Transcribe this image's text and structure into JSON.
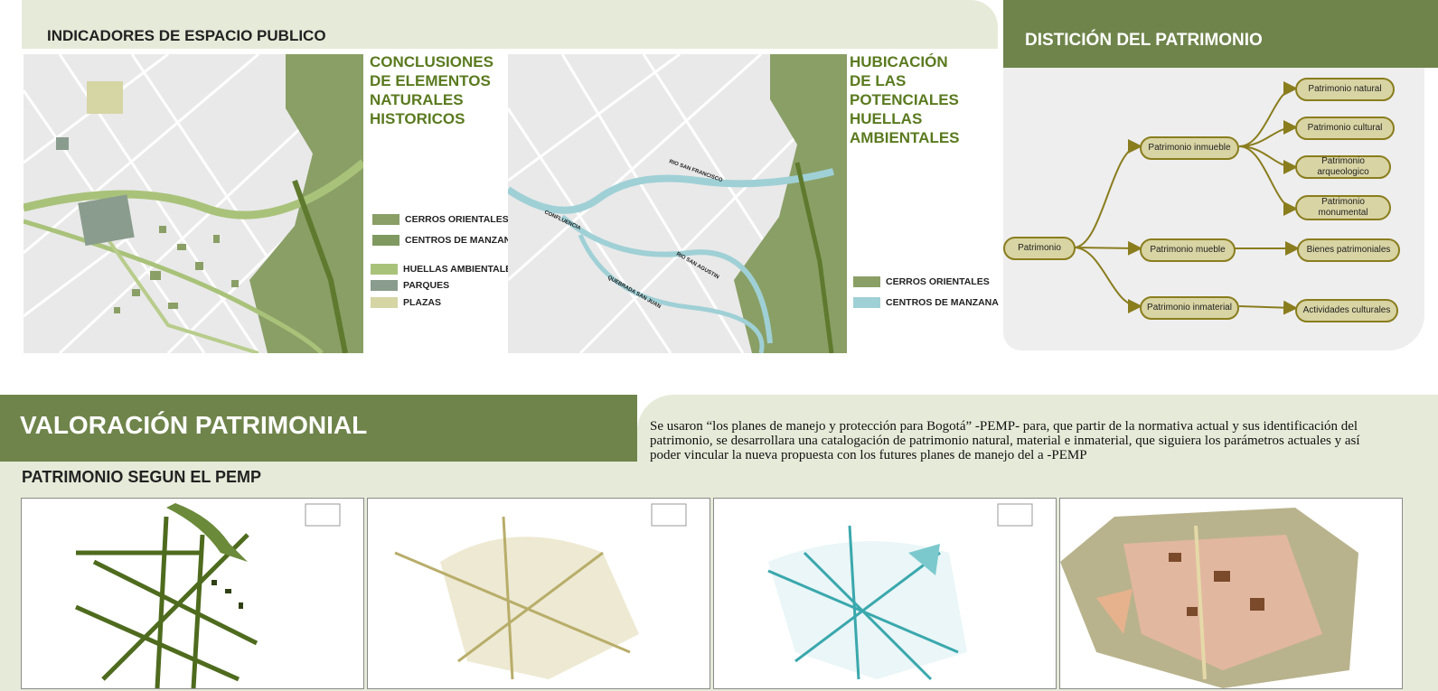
{
  "header": {
    "title": "INDICADORES DE ESPACIO PUBLICO"
  },
  "map1": {
    "title_lines": [
      "CONCLUSIONES",
      "DE ELEMENTOS",
      "NATURALES",
      "HISTORICOS"
    ],
    "legend": [
      {
        "label": "CERROS ORIENTALES",
        "color": "#8a9f66"
      },
      {
        "label": "CENTROS DE MANZANA",
        "color": "#7f9960"
      },
      {
        "label": "HUELLAS AMBIENTALES",
        "color": "#a9c27a"
      },
      {
        "label": "PARQUES",
        "color": "#8a9c8d"
      },
      {
        "label": "PLAZAS",
        "color": "#d6d5a4"
      }
    ]
  },
  "map2": {
    "title_lines": [
      "HUBICACIÓN",
      "DE LAS",
      "POTENCIALES",
      "HUELLAS",
      "AMBIENTALES"
    ],
    "legend": [
      {
        "label": "CERROS ORIENTALES",
        "color": "#8a9f66"
      },
      {
        "label": "CENTROS DE MANZANA",
        "color": "#9fd0d6"
      }
    ],
    "river_labels": [
      "RIO SAN FRANCISCO",
      "CONFLUENCIA",
      "RIO SAN AGUSTIN",
      "QUEBRADA SAN JUAN"
    ]
  },
  "distincion": {
    "title": "DISTICIÓN DEL PATRIMONIO",
    "nodes": {
      "root": "Patrimonio",
      "inmueble": "Patrimonio inmueble",
      "mueble": "Patrimonio mueble",
      "inmaterial": "Patrimonio inmaterial",
      "natural": "Patrimonio natural",
      "cultural": "Patrimonio cultural",
      "arqueologico": "Patrimonio arqueologico",
      "monumental": "Patrimonio monumental",
      "bienes": "Bienes patrimoniales",
      "actividades": "Actividades culturales"
    }
  },
  "valoracion": {
    "title": "VALORACIÓN PATRIMONIAL",
    "text": "Se usaron “los planes de manejo y protección para Bogotá” -PEMP- para, que partir de la normativa actual y sus identificación del patrimonio, se desarrollara una catalogación de patrimonio natural, material e inmaterial, que  siguiera los parámetros actuales y así poder vincular la nueva propuesta con los futures planes de  manejo del a -PEMP"
  },
  "pemp": {
    "title": "PATRIMONIO SEGUN EL PEMP"
  },
  "colors": {
    "primary_green": "#6f844b",
    "light_green_bg": "#e6ebd9",
    "node_fill": "#d8d4a4",
    "node_stroke": "#8a7d1e",
    "teal": "#3aa8ad"
  }
}
